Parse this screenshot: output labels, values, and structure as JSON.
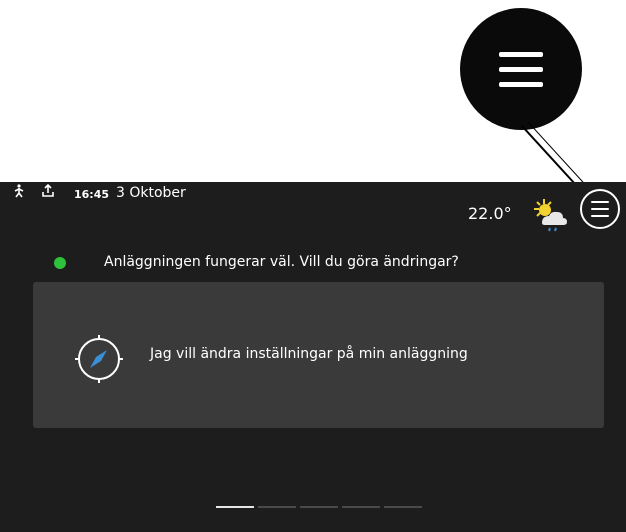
{
  "header": {
    "time": "16:45",
    "date": "3 Oktober",
    "temperature": "22.0°",
    "status_icons": [
      "person-walking-icon",
      "upload-icon"
    ],
    "weather_icon": "partly-cloudy-rain-icon",
    "menu_icon": "hamburger-menu-icon"
  },
  "callout": {
    "icon": "hamburger-menu-icon"
  },
  "status": {
    "color": "#2ec13b",
    "message": "Anläggningen fungerar väl. Vill du göra ändringar?"
  },
  "card": {
    "icon": "compass-icon",
    "label": "Jag vill ändra inställningar på min anläggning"
  },
  "pager": {
    "pages": 5,
    "active_index": 0
  },
  "colors": {
    "background": "#1d1d1d",
    "card": "#3a3a3a",
    "accent_compass": "#3a8fd6",
    "status_ok": "#2ec13b"
  }
}
